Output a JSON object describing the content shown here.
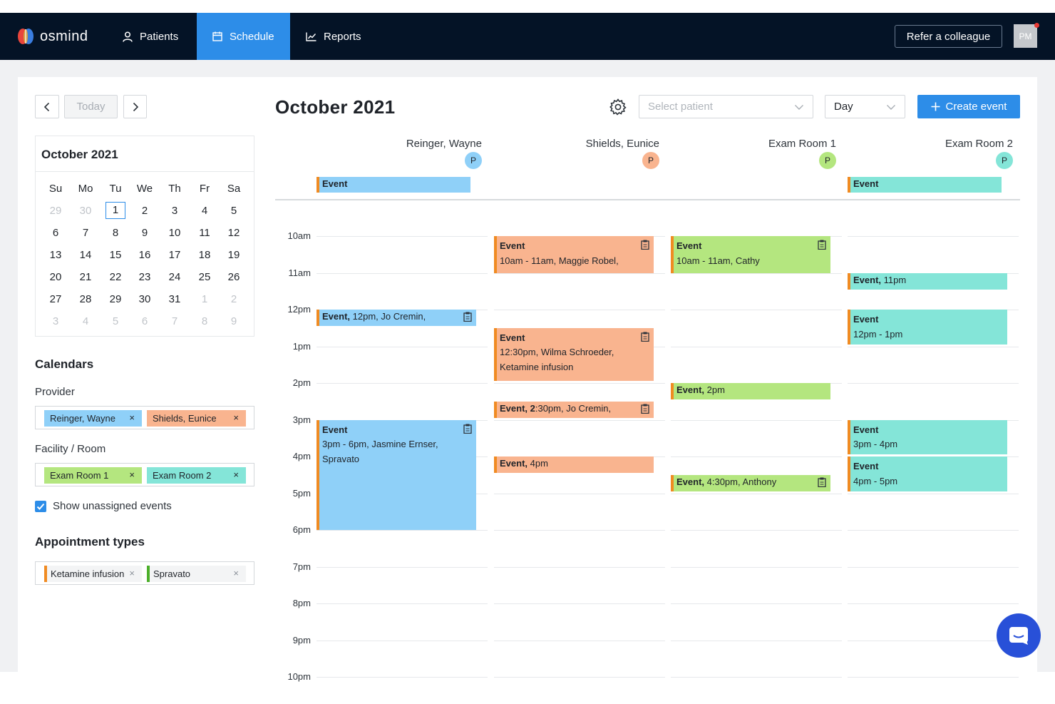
{
  "app": {
    "logo_text": "osmind"
  },
  "nav": {
    "patients": "Patients",
    "schedule": "Schedule",
    "reports": "Reports",
    "refer": "Refer a colleague",
    "avatar": "PM"
  },
  "toolbar": {
    "today": "Today",
    "title": "October 2021",
    "patient_placeholder": "Select patient",
    "view": "Day",
    "create": "Create event"
  },
  "mini_calendar": {
    "title": "October 2021",
    "weekdays": [
      "Su",
      "Mo",
      "Tu",
      "We",
      "Th",
      "Fr",
      "Sa"
    ],
    "weeks": [
      [
        "29",
        "30",
        "1",
        "2",
        "3",
        "4",
        "5"
      ],
      [
        "6",
        "7",
        "8",
        "9",
        "10",
        "11",
        "12"
      ],
      [
        "13",
        "14",
        "15",
        "16",
        "17",
        "18",
        "19"
      ],
      [
        "20",
        "21",
        "22",
        "23",
        "24",
        "25",
        "26"
      ],
      [
        "27",
        "28",
        "29",
        "30",
        "31",
        "1",
        "2"
      ],
      [
        "3",
        "4",
        "5",
        "6",
        "7",
        "8",
        "9"
      ]
    ],
    "selected_day": "1"
  },
  "sidebar": {
    "calendars_title": "Calendars",
    "provider_label": "Provider",
    "providers": [
      "Reinger, Wayne",
      "Shields, Eunice"
    ],
    "facility_label": "Facility / Room",
    "rooms": [
      "Exam Room 1",
      "Exam Room 2"
    ],
    "show_unassigned": "Show unassigned events",
    "show_unassigned_checked": true,
    "appointment_title": "Appointment types",
    "appointment_types": [
      "Ketamine infusion",
      "Spravato"
    ],
    "remove_icon": "×"
  },
  "columns": [
    {
      "name": "Reinger, Wayne",
      "badge": "P",
      "color": "#8fd0f8"
    },
    {
      "name": "Shields, Eunice",
      "badge": "P",
      "color": "#f9b48f"
    },
    {
      "name": "Exam Room 1",
      "badge": "P",
      "color": "#b4e67f"
    },
    {
      "name": "Exam Room 2",
      "badge": "P",
      "color": "#84e5d8"
    }
  ],
  "hours": [
    "10am",
    "11am",
    "12pm",
    "1pm",
    "2pm",
    "3pm",
    "4pm",
    "5pm",
    "6pm",
    "7pm",
    "8pm",
    "9pm",
    "10pm"
  ],
  "all_day_events": [
    {
      "col": 0,
      "title": "Event"
    },
    {
      "col": 3,
      "title": "Event"
    }
  ],
  "events": [
    {
      "col": 0,
      "start": 12.0,
      "end": 12.45,
      "title": "Event,",
      "detail": " 12pm, Jo Cremin,",
      "inline": true,
      "clipboard": true
    },
    {
      "col": 0,
      "start": 15.0,
      "end": 18.0,
      "title": "Event",
      "lines": [
        "3pm - 6pm, Jasmine Ernser,",
        "Spravato"
      ],
      "clipboard": true
    },
    {
      "col": 1,
      "start": 10.0,
      "end": 11.0,
      "title": "Event",
      "lines": [
        "10am - 11am, Maggie Robel,"
      ],
      "clipboard": true
    },
    {
      "col": 1,
      "start": 12.5,
      "end": 13.95,
      "title": "Event",
      "lines": [
        "12:30pm, Wilma Schroeder,",
        "Ketamine infusion"
      ],
      "clipboard": true
    },
    {
      "col": 1,
      "start": 14.5,
      "end": 14.95,
      "title": "Event, 2",
      "detail": ":30pm, Jo Cremin,",
      "inline": true,
      "clipboard": true
    },
    {
      "col": 1,
      "start": 16.0,
      "end": 16.45,
      "title": "Event,",
      "detail": " 4pm",
      "inline": true,
      "clipboard": false
    },
    {
      "col": 2,
      "start": 10.0,
      "end": 11.0,
      "title": "Event",
      "lines": [
        "10am - 11am, Cathy"
      ],
      "clipboard": true
    },
    {
      "col": 2,
      "start": 14.0,
      "end": 14.45,
      "title": "Event,",
      "detail": " 2pm",
      "inline": true,
      "clipboard": false
    },
    {
      "col": 2,
      "start": 16.5,
      "end": 16.95,
      "title": "Event,",
      "detail": " 4:30pm, Anthony",
      "inline": true,
      "clipboard": true
    },
    {
      "col": 3,
      "start": 11.0,
      "end": 11.45,
      "title": "Event,",
      "detail": " 11pm",
      "inline": true,
      "clipboard": false
    },
    {
      "col": 3,
      "start": 12.0,
      "end": 12.95,
      "title": "Event",
      "lines": [
        "12pm - 1pm"
      ],
      "clipboard": false
    },
    {
      "col": 3,
      "start": 15.0,
      "end": 15.95,
      "title": "Event",
      "lines": [
        "3pm - 4pm"
      ],
      "clipboard": false
    },
    {
      "col": 3,
      "start": 16.0,
      "end": 16.95,
      "title": "Event",
      "lines": [
        "4pm - 5pm"
      ],
      "clipboard": false
    }
  ],
  "icons": {
    "prev": "chevron-left-icon",
    "next": "chevron-right-icon",
    "settings": "gear-icon",
    "chat": "chat-icon",
    "clipboard": "clipboard-icon"
  }
}
